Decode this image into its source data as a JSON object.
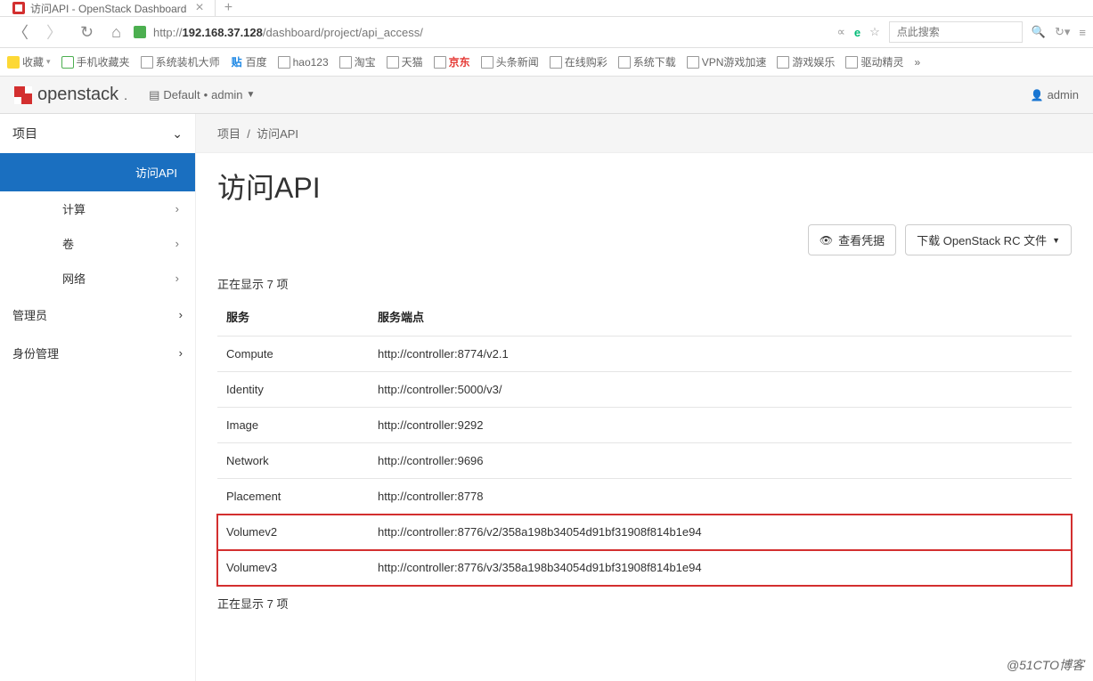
{
  "browser": {
    "tab_title": "访问API - OpenStack Dashboard",
    "url_prefix": "http://",
    "url_host": "192.168.37.128",
    "url_path": "/dashboard/project/api_access/",
    "search_placeholder": "点此搜索"
  },
  "bookmarks": {
    "fav_label": "收藏",
    "mobile": "手机收藏夹",
    "items": [
      "系统装机大师",
      "百度",
      "hao123",
      "淘宝",
      "天猫",
      "京东",
      "头条新闻",
      "在线购彩",
      "系统下载",
      "VPN游戏加速",
      "游戏娱乐",
      "驱动精灵"
    ],
    "more": "»"
  },
  "topbar": {
    "brand": "openstack",
    "project_domain": "Default",
    "project_name": "admin",
    "user": "admin"
  },
  "sidebar": {
    "group_project": "项目",
    "item_api": "访问API",
    "item_compute": "计算",
    "item_volume": "卷",
    "item_network": "网络",
    "group_admin": "管理员",
    "group_identity": "身份管理"
  },
  "main": {
    "crumb_project": "项目",
    "crumb_current": "访问API",
    "title": "访问API",
    "btn_credentials": "查看凭据",
    "btn_download": "下载 OpenStack RC 文件",
    "counter_top": "正在显示 7 项",
    "th_service": "服务",
    "th_endpoint": "服务端点",
    "rows": [
      {
        "service": "Compute",
        "endpoint": "http://controller:8774/v2.1"
      },
      {
        "service": "Identity",
        "endpoint": "http://controller:5000/v3/"
      },
      {
        "service": "Image",
        "endpoint": "http://controller:9292"
      },
      {
        "service": "Network",
        "endpoint": "http://controller:9696"
      },
      {
        "service": "Placement",
        "endpoint": "http://controller:8778"
      },
      {
        "service": "Volumev2",
        "endpoint": "http://controller:8776/v2/358a198b34054d91bf31908f814b1e94"
      },
      {
        "service": "Volumev3",
        "endpoint": "http://controller:8776/v3/358a198b34054d91bf31908f814b1e94"
      }
    ],
    "counter_bottom": "正在显示 7 项"
  },
  "watermark": "@51CTO博客"
}
